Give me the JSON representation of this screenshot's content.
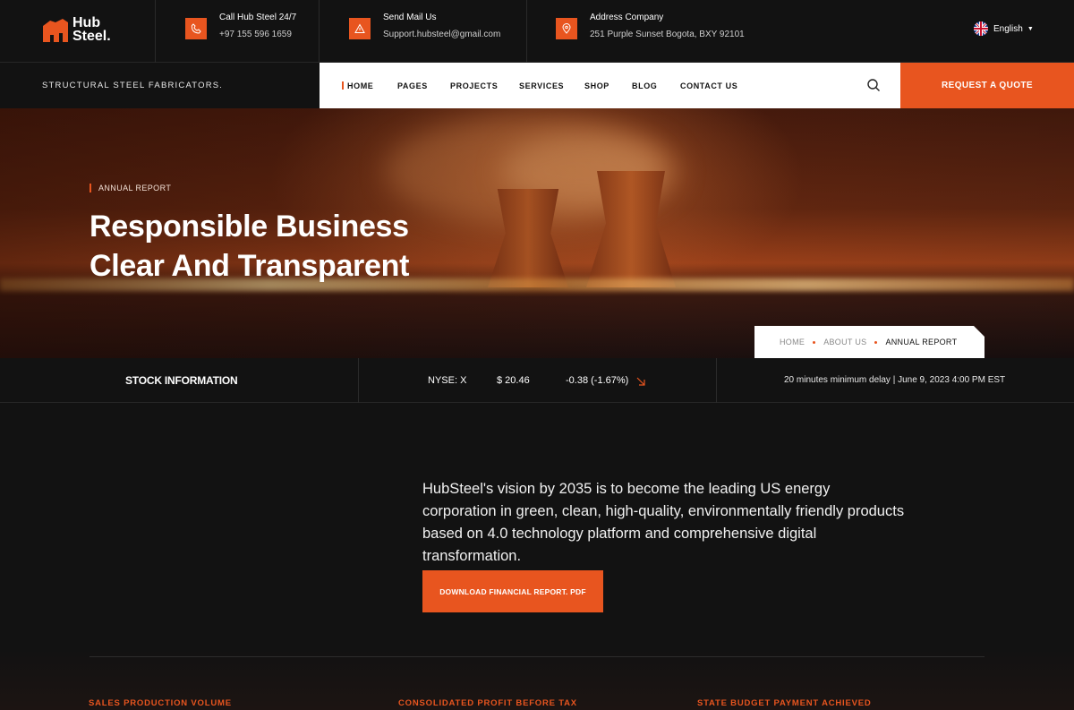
{
  "brand": {
    "line1": "Hub",
    "line2": "Steel.",
    "accent": "#e8551f"
  },
  "contacts": [
    {
      "icon": "phone-icon",
      "title": "Call Hub Steel 24/7",
      "value": "+97 155 596 1659"
    },
    {
      "icon": "mail-icon",
      "title": "Send Mail Us",
      "value": "Support.hubsteel@gmail.com"
    },
    {
      "icon": "location-pin-icon",
      "title": "Address Company",
      "value": "251 Purple Sunset Bogota, BXY 92101"
    }
  ],
  "language": {
    "label": "English",
    "flag": "uk-flag-icon"
  },
  "tagline": "STRUCTURAL STEEL FABRICATORS.",
  "nav": {
    "items": [
      "HOME",
      "PAGES",
      "PROJECTS",
      "SERVICES",
      "SHOP",
      "BLOG",
      "CONTACT US"
    ],
    "active": "HOME"
  },
  "quote_button": "REQUEST A QUOTE",
  "hero": {
    "eyebrow": "ANNUAL REPORT",
    "title_line1": "Responsible Business",
    "title_line2": "Clear And Transparent"
  },
  "breadcrumb": {
    "items": [
      "HOME",
      "ABOUT US"
    ],
    "current": "ANNUAL REPORT"
  },
  "stock": {
    "title": "STOCK INFORMATION",
    "ticker": "NYSE: X",
    "price": "$ 20.46",
    "change": "-0.38 (-1.67%)",
    "trend": "down",
    "delay": "20 minutes minimum delay | June 9, 2023 4:00 PM EST"
  },
  "vision": "HubSteel's vision by 2035 is to become the leading US energy corporation in green, clean, high-quality, environmentally friendly products based on 4.0 technology platform and comprehensive digital transformation.",
  "download_button": "DOWNLOAD FINANCIAL REPORT. PDF",
  "kpis": [
    "SALES PRODUCTION VOLUME",
    "CONSOLIDATED PROFIT BEFORE TAX",
    "STATE BUDGET PAYMENT ACHIEVED"
  ]
}
